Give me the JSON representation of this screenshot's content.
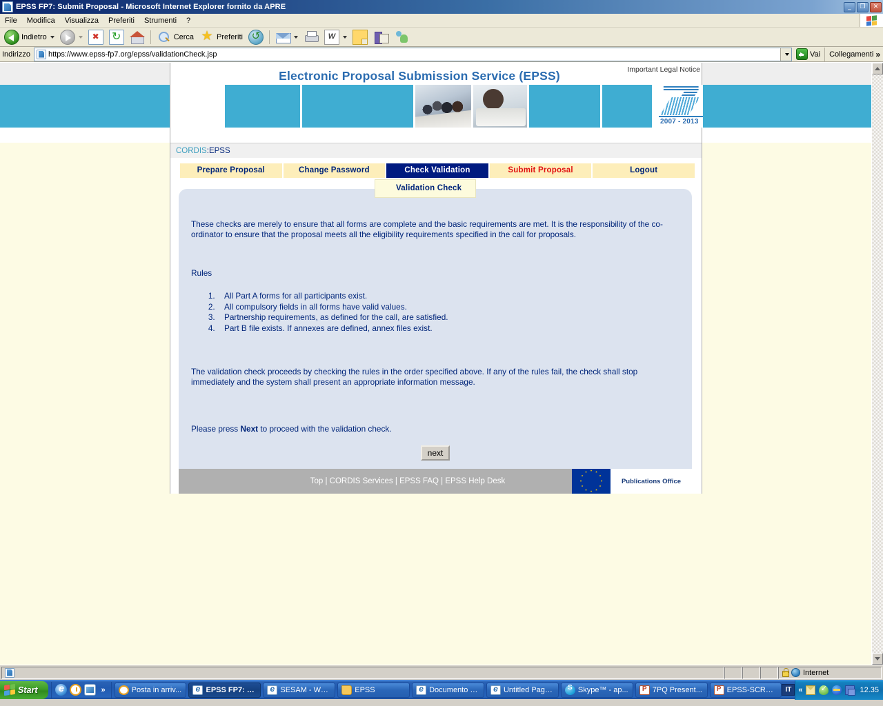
{
  "window": {
    "title": "EPSS FP7: Submit Proposal - Microsoft Internet Explorer fornito da APRE",
    "minimize": "_",
    "restore": "❐",
    "close": "✕"
  },
  "menu": {
    "items": [
      "File",
      "Modifica",
      "Visualizza",
      "Preferiti",
      "Strumenti",
      "?"
    ]
  },
  "toolbar": {
    "back": "Indietro",
    "search": "Cerca",
    "favorites": "Preferiti"
  },
  "address": {
    "label": "Indirizzo",
    "url": "https://www.epss-fp7.org/epss/validationCheck.jsp",
    "go": "Vai",
    "links": "Collegamenti",
    "links_chevron": "»"
  },
  "page": {
    "legal_notice": "Important Legal Notice",
    "title": "Electronic Proposal Submission Service  (EPSS)",
    "logo_years": "2007 - 2013",
    "breadcrumb": {
      "root": "CORDIS",
      "sep": ": ",
      "current": "EPSS"
    },
    "tabs": [
      {
        "label": "Prepare Proposal",
        "state": "normal"
      },
      {
        "label": "Change Password",
        "state": "normal"
      },
      {
        "label": "Check Validation",
        "state": "active"
      },
      {
        "label": "Submit Proposal",
        "state": "red"
      },
      {
        "label": "Logout",
        "state": "normal"
      }
    ],
    "subtab": "Validation Check",
    "intro": "These checks are merely to ensure that all forms are complete and the basic requirements are met. It is the responsibility of the co-ordinator to ensure that the proposal meets all the eligibility requirements specified in the call for proposals.",
    "rules_heading": "Rules",
    "rules": [
      "All Part A forms for all participants exist.",
      "All compulsory fields in all forms have valid values.",
      "Partnership requirements, as defined for the call, are satisfied.",
      "Part B file exists. If annexes are defined, annex files exist."
    ],
    "procedure": "The validation check proceeds by checking the rules in the order specified above. If any of the rules fail, the check shall stop immediately and the system shall present an appropriate information message.",
    "press_prefix": "Please press ",
    "press_bold": "Next",
    "press_suffix": " to proceed with the validation check.",
    "next_button": "next",
    "footer_links": "Top | CORDIS Services | EPSS FAQ | EPSS Help Desk",
    "publications_office": "Publications Office"
  },
  "statusbar": {
    "message": "",
    "zone": "Internet"
  },
  "taskbar": {
    "start": "Start",
    "quick_chevron": "»",
    "tasks": [
      {
        "label": "Posta in arriv...",
        "icon": "clock",
        "active": false
      },
      {
        "label": "EPSS FP7: S...",
        "icon": "ie",
        "active": true
      },
      {
        "label": "SESAM - Wel...",
        "icon": "ie",
        "active": false
      },
      {
        "label": "EPSS",
        "icon": "folder",
        "active": false
      },
      {
        "label": "Documento s...",
        "icon": "ie",
        "active": false
      },
      {
        "label": "Untitled Page...",
        "icon": "ie",
        "active": false
      },
      {
        "label": "Skype™ - ap...",
        "icon": "skype",
        "active": false
      },
      {
        "label": "7PQ Present...",
        "icon": "ppt",
        "active": false
      },
      {
        "label": "EPSS-SCREE...",
        "icon": "ppt",
        "active": false
      }
    ],
    "language": "IT",
    "tray_chevron": "«",
    "clock": "12.35"
  },
  "colors": {
    "banner_blue": "#3fadd2",
    "title_blue": "#2b6cb0",
    "tab_yellow": "#fdeeba",
    "tab_active": "#001a80",
    "tab_red": "#e01010",
    "panel_blue": "#dce3ef",
    "page_bg": "#fdfbe4",
    "footer_grey": "#b0b0b0",
    "eu_blue": "#003399",
    "eu_yellow": "#ffcc00"
  }
}
